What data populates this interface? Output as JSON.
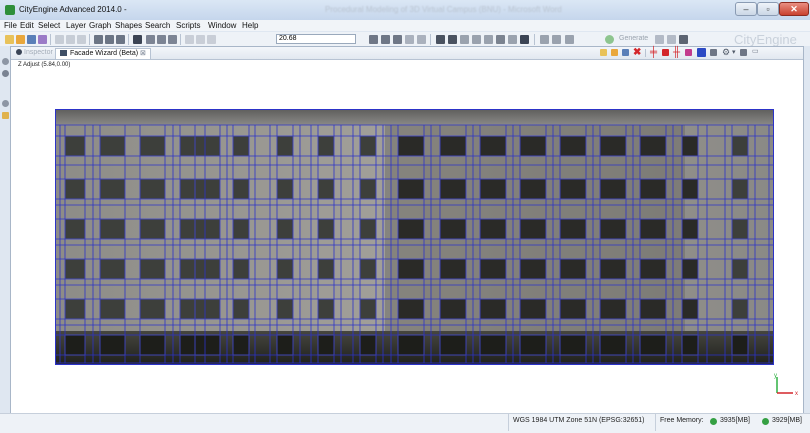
{
  "window": {
    "title": "CityEngine Advanced 2014.0 -",
    "blurred_title": "Procedural Modeling of 3D Virtual Campus (BNU) - Microsoft Word"
  },
  "menu": [
    "File",
    "Edit",
    "Select",
    "Layer",
    "Graph",
    "Shapes",
    "Search",
    "Scripts",
    "Window",
    "Help"
  ],
  "toolbar": {
    "zoom_value": "20.68",
    "generate_label": "Generate",
    "brand": "CityEngine"
  },
  "tabs": {
    "inspector": "Inspector",
    "facade_wizard": "Facade Wizard (Beta)",
    "close_glyph": "⊠"
  },
  "viewport": {
    "adjust_label": "Z Adjust (5.84,0.00)",
    "axis_y": "y",
    "axis_x": "x"
  },
  "status": {
    "crs": "WGS 1984 UTM Zone 51N (EPSG:32651)",
    "free_memory_label": "Free Memory:",
    "mem1": "3935[MB]",
    "mem2": "3929[MB]"
  },
  "colors": {
    "grid": "#2c33c8",
    "accent": "#2f8f3a"
  }
}
